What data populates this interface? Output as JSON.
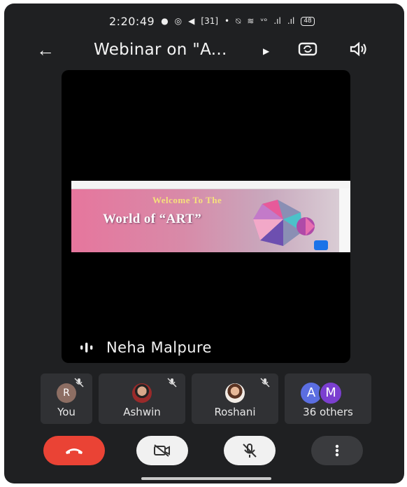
{
  "status_bar": {
    "time": "2:20:49",
    "calendar_badge": "31",
    "battery": "48"
  },
  "header": {
    "title": "Webinar on \"A..."
  },
  "stage": {
    "slide": {
      "heading": "Welcome To The",
      "subheading": "World of “ART”"
    },
    "presenter_name": "Neha Malpure"
  },
  "participants": [
    {
      "initial": "R",
      "label": "You",
      "muted": true
    },
    {
      "label": "Ashwin",
      "muted": true
    },
    {
      "label": "Roshani",
      "muted": true
    },
    {
      "initials": [
        "A",
        "M"
      ],
      "label": "36 others"
    }
  ],
  "colors": {
    "background": "#1f2022",
    "tile": "#303134",
    "end_call": "#ea4335",
    "control_white": "#f1f1f1",
    "avatar_a": "#5b6ee1",
    "avatar_m": "#7b3fd0"
  },
  "controls": {
    "end_call_icon": "phone-hangup-icon",
    "camera_icon": "camera-off-icon",
    "mic_icon": "mic-off-icon",
    "more_icon": "more-vert-icon"
  }
}
